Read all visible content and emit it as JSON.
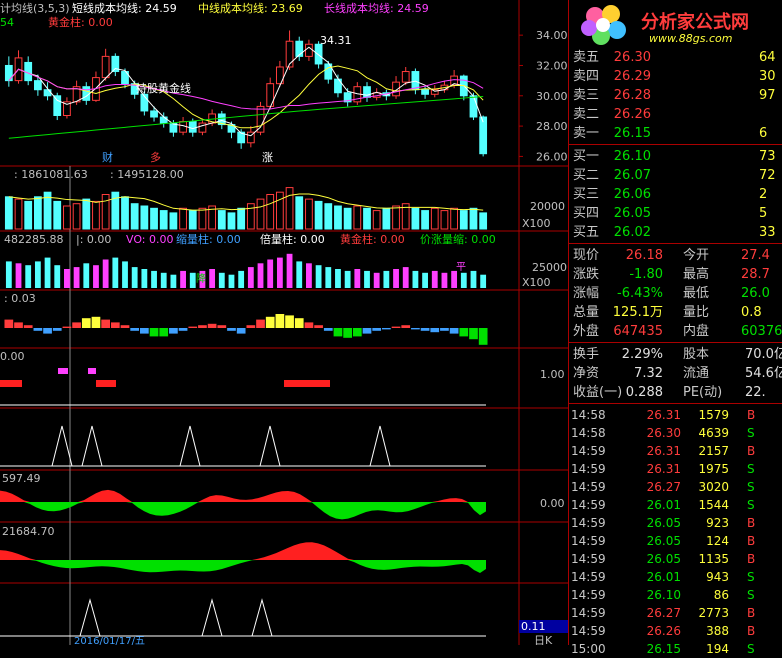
{
  "header": {
    "main_title": "计均线(3,5,3)",
    "short_ma": "短线成本均线: 24.59",
    "mid_ma": "中线成本均线: 23.69",
    "long_ma": "长线成本均线: 24.59",
    "sub_label_a": "54",
    "gold_pillar": "黄金柱: 0.00",
    "gold_line_label": "持股黄金线",
    "high_mark": "34.31",
    "tag_cai": "财",
    "tag_duo": "多",
    "tag_zhang": "涨"
  },
  "price_axis": [
    "34.00",
    "32.00",
    "30.00",
    "28.00",
    "26.00"
  ],
  "volume_panel": {
    "label_a": ": 1861081.63",
    "label_b": ": 1495128.00",
    "axis_value": "20000",
    "unit": "X100"
  },
  "vo_panel": {
    "label_a": "482285.88",
    "label_b": "|: 0.00",
    "vo": "VO: 0.00",
    "shrink": "缩量柱: 0.00",
    "double": "倍量柱: 0.00",
    "gold": "黄金柱: 0.00",
    "rise_shrink": "价涨量缩: 0.00",
    "axis_value": "25000",
    "unit": "X100",
    "mark_ping": "平",
    "mark_jiang": "降"
  },
  "macd_panel": {
    "label": ": 0.03"
  },
  "signal_panel": {
    "label": "0.00",
    "axis_value": "1.00"
  },
  "wave_panel": {
    "label": "597.49",
    "axis_value": "0.00"
  },
  "wave2_panel": {
    "label": "21684.70"
  },
  "bottom": {
    "date_label": "2016/01/17/五",
    "value": "0.11",
    "corner": "日K"
  },
  "logo": {
    "name": "分析家公式网",
    "url": "www.88gs.com"
  },
  "order_book": {
    "sell": [
      {
        "label": "卖五",
        "price": "26.30",
        "vol": "64"
      },
      {
        "label": "卖四",
        "price": "26.29",
        "vol": "30"
      },
      {
        "label": "卖三",
        "price": "26.28",
        "vol": "97"
      },
      {
        "label": "卖二",
        "price": "26.26",
        "vol": ""
      },
      {
        "label": "卖一",
        "price": "26.15",
        "vol": "6"
      }
    ],
    "buy": [
      {
        "label": "买一",
        "price": "26.10",
        "vol": "73"
      },
      {
        "label": "买二",
        "price": "26.07",
        "vol": "72"
      },
      {
        "label": "买三",
        "price": "26.06",
        "vol": "2"
      },
      {
        "label": "买四",
        "price": "26.05",
        "vol": "5"
      },
      {
        "label": "买五",
        "price": "26.02",
        "vol": "33"
      }
    ]
  },
  "quote": [
    {
      "k1": "现价",
      "v1": "26.18",
      "c1": "red",
      "k2": "今开",
      "v2": "27.4",
      "c2": "red"
    },
    {
      "k1": "涨跌",
      "v1": "-1.80",
      "c1": "grn",
      "k2": "最高",
      "v2": "28.7",
      "c2": "red"
    },
    {
      "k1": "涨幅",
      "v1": "-6.43%",
      "c1": "grn",
      "k2": "最低",
      "v2": "26.0",
      "c2": "grn"
    },
    {
      "k1": "总量",
      "v1": "125.1万",
      "c1": "yel",
      "k2": "量比",
      "v2": "0.8",
      "c2": "yel"
    },
    {
      "k1": "外盘",
      "v1": "647435",
      "c1": "red",
      "k2": "内盘",
      "v2": "60376",
      "c2": "grn"
    }
  ],
  "finance": [
    {
      "k1": "换手",
      "v1": "2.29%",
      "k2": "股本",
      "v2": "70.0亿"
    },
    {
      "k1": "净资",
      "v1": "7.32",
      "k2": "流通",
      "v2": "54.6亿"
    },
    {
      "k1": "收益(一)",
      "v1": "0.288",
      "k2": "PE(动)",
      "v2": "22."
    }
  ],
  "ticks": [
    {
      "t": "14:58",
      "p": "26.31",
      "v": "1579",
      "s": "B"
    },
    {
      "t": "14:58",
      "p": "26.30",
      "v": "4639",
      "s": "S"
    },
    {
      "t": "14:59",
      "p": "26.31",
      "v": "2157",
      "s": "B"
    },
    {
      "t": "14:59",
      "p": "26.31",
      "v": "1975",
      "s": "S"
    },
    {
      "t": "14:59",
      "p": "26.27",
      "v": "3020",
      "s": "S"
    },
    {
      "t": "14:59",
      "p": "26.01",
      "v": "1544",
      "s": "S"
    },
    {
      "t": "14:59",
      "p": "26.05",
      "v": "923",
      "s": "B"
    },
    {
      "t": "14:59",
      "p": "26.05",
      "v": "124",
      "s": "B"
    },
    {
      "t": "14:59",
      "p": "26.05",
      "v": "1135",
      "s": "B"
    },
    {
      "t": "14:59",
      "p": "26.01",
      "v": "943",
      "s": "S"
    },
    {
      "t": "14:59",
      "p": "26.10",
      "v": "86",
      "s": "S"
    },
    {
      "t": "14:59",
      "p": "26.27",
      "v": "2773",
      "s": "B"
    },
    {
      "t": "14:59",
      "p": "26.26",
      "v": "388",
      "s": "B"
    },
    {
      "t": "15:00",
      "p": "26.15",
      "v": "194",
      "s": "S"
    }
  ],
  "chart_data": {
    "type": "bar",
    "candles": [
      [
        32.0,
        31.0,
        32.6,
        30.6
      ],
      [
        31.0,
        32.5,
        33.0,
        30.8
      ],
      [
        32.2,
        31.0,
        32.6,
        30.7
      ],
      [
        31.0,
        30.4,
        31.4,
        30.0
      ],
      [
        30.4,
        30.0,
        30.9,
        29.7
      ],
      [
        30.0,
        28.7,
        30.2,
        28.4
      ],
      [
        28.7,
        29.6,
        29.9,
        28.5
      ],
      [
        29.6,
        30.6,
        31.0,
        29.4
      ],
      [
        30.6,
        29.7,
        30.9,
        29.4
      ],
      [
        29.7,
        31.2,
        31.6,
        29.6
      ],
      [
        31.2,
        32.6,
        33.1,
        31.0
      ],
      [
        32.6,
        31.6,
        32.8,
        31.3
      ],
      [
        31.6,
        30.8,
        31.8,
        30.5
      ],
      [
        30.8,
        30.1,
        31.0,
        29.8
      ],
      [
        30.1,
        29.0,
        30.3,
        28.7
      ],
      [
        29.0,
        28.6,
        29.3,
        28.3
      ],
      [
        28.6,
        28.2,
        28.9,
        27.9
      ],
      [
        28.2,
        27.6,
        28.4,
        27.3
      ],
      [
        27.6,
        28.3,
        28.6,
        27.4
      ],
      [
        28.3,
        27.6,
        28.5,
        27.3
      ],
      [
        27.6,
        28.2,
        28.5,
        27.4
      ],
      [
        28.2,
        28.8,
        29.1,
        28.0
      ],
      [
        28.8,
        28.1,
        29.0,
        27.8
      ],
      [
        28.1,
        27.6,
        28.3,
        27.2
      ],
      [
        27.6,
        26.9,
        27.8,
        26.5
      ],
      [
        26.9,
        27.6,
        28.0,
        26.6
      ],
      [
        27.6,
        29.3,
        29.6,
        27.4
      ],
      [
        29.3,
        30.8,
        31.2,
        29.1
      ],
      [
        30.8,
        31.9,
        32.3,
        30.6
      ],
      [
        31.9,
        33.6,
        34.31,
        31.7
      ],
      [
        33.6,
        32.6,
        33.9,
        32.3
      ],
      [
        32.6,
        33.4,
        33.7,
        32.3
      ],
      [
        33.4,
        32.1,
        33.6,
        31.8
      ],
      [
        32.1,
        31.1,
        32.3,
        30.8
      ],
      [
        31.1,
        30.2,
        31.4,
        29.9
      ],
      [
        30.2,
        29.6,
        30.5,
        29.3
      ],
      [
        29.6,
        30.6,
        30.9,
        29.4
      ],
      [
        30.6,
        29.9,
        30.9,
        29.6
      ],
      [
        29.9,
        30.2,
        30.5,
        29.7
      ],
      [
        30.2,
        30.0,
        30.4,
        29.7
      ],
      [
        30.0,
        30.9,
        31.3,
        29.8
      ],
      [
        30.9,
        31.6,
        31.9,
        30.7
      ],
      [
        31.6,
        30.4,
        31.8,
        30.1
      ],
      [
        30.4,
        30.1,
        30.6,
        29.8
      ],
      [
        30.1,
        30.4,
        30.7,
        29.9
      ],
      [
        30.4,
        30.7,
        31.0,
        30.2
      ],
      [
        30.7,
        31.3,
        31.7,
        30.5
      ],
      [
        31.3,
        30.0,
        31.4,
        29.7
      ],
      [
        30.0,
        28.6,
        30.2,
        28.4
      ],
      [
        28.6,
        26.18,
        28.7,
        26.0
      ]
    ],
    "volume": [
      14,
      13,
      12,
      14,
      16,
      12,
      10,
      11,
      13,
      12,
      15,
      16,
      14,
      11,
      10,
      9,
      8,
      7,
      9,
      8,
      9,
      10,
      8,
      7,
      9,
      11,
      13,
      15,
      16,
      18,
      14,
      13,
      12,
      11,
      10,
      9,
      10,
      9,
      8,
      9,
      10,
      11,
      9,
      8,
      9,
      8,
      9,
      8,
      9,
      7
    ],
    "macd": [
      0.3,
      0.2,
      0.1,
      -0.1,
      -0.2,
      -0.1,
      0.05,
      0.2,
      0.35,
      0.4,
      0.3,
      0.2,
      0.1,
      -0.1,
      -0.2,
      -0.3,
      -0.3,
      -0.2,
      -0.1,
      0.05,
      0.1,
      0.15,
      0.1,
      -0.1,
      -0.2,
      0.1,
      0.3,
      0.4,
      0.5,
      0.45,
      0.35,
      0.2,
      0.1,
      -0.1,
      -0.3,
      -0.35,
      -0.3,
      -0.2,
      -0.1,
      -0.05,
      0.05,
      0.1,
      -0.05,
      -0.1,
      -0.15,
      -0.1,
      -0.2,
      -0.3,
      -0.4,
      -0.6
    ],
    "ylim": [
      25.5,
      35.0
    ]
  }
}
